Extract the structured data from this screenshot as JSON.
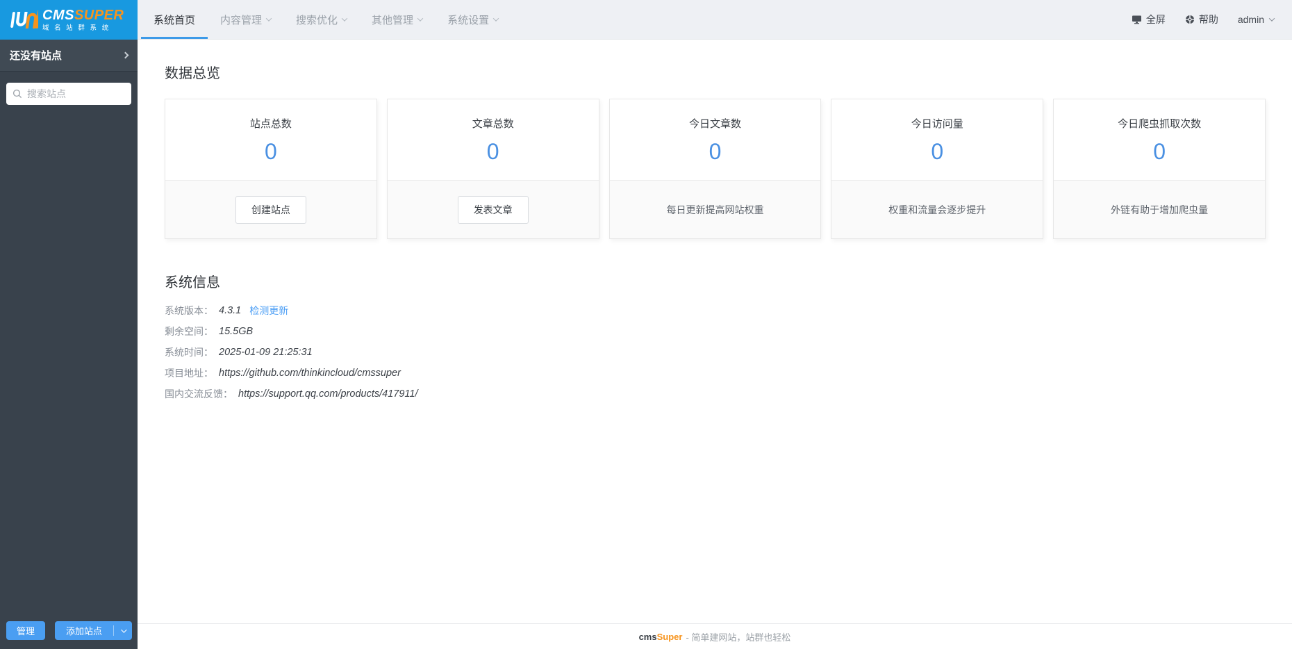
{
  "logo": {
    "brand_cms": "CMS",
    "brand_super": "SUPER",
    "subtitle": "域 名 站 群 系 统"
  },
  "nav": {
    "tabs": [
      {
        "label": "系统首页",
        "active": true,
        "dropdown": false
      },
      {
        "label": "内容管理",
        "active": false,
        "dropdown": true
      },
      {
        "label": "搜索优化",
        "active": false,
        "dropdown": true
      },
      {
        "label": "其他管理",
        "active": false,
        "dropdown": true
      },
      {
        "label": "系统设置",
        "active": false,
        "dropdown": true
      }
    ]
  },
  "topbar": {
    "fullscreen_label": "全屏",
    "help_label": "帮助",
    "user_label": "admin"
  },
  "sidebar": {
    "no_sites_label": "还没有站点",
    "search_placeholder": "搜索站点",
    "manage_button": "管理",
    "add_site_button": "添加站点"
  },
  "overview": {
    "title": "数据总览",
    "cards": [
      {
        "title": "站点总数",
        "value": "0",
        "action": "创建站点"
      },
      {
        "title": "文章总数",
        "value": "0",
        "action": "发表文章"
      },
      {
        "title": "今日文章数",
        "value": "0",
        "note": "每日更新提高网站权重"
      },
      {
        "title": "今日访问量",
        "value": "0",
        "note": "权重和流量会逐步提升"
      },
      {
        "title": "今日爬虫抓取次数",
        "value": "0",
        "note": "外链有助于增加爬虫量"
      }
    ]
  },
  "system_info": {
    "title": "系统信息",
    "rows": [
      {
        "label": "系统版本：",
        "value": "4.3.1",
        "link": "检测更新"
      },
      {
        "label": "剩余空间：",
        "value": "15.5GB"
      },
      {
        "label": "系统时间：",
        "value": "2025-01-09 21:25:31"
      },
      {
        "label": "项目地址：",
        "value": "https://github.com/thinkincloud/cmssuper"
      },
      {
        "label": "国内交流反馈：",
        "value": "https://support.qq.com/products/417911/"
      }
    ]
  },
  "footer": {
    "brand_cms": "cms",
    "brand_super": "Super",
    "tagline": "- 简单建网站，站群也轻松"
  },
  "colors": {
    "brand_blue": "#1899e0",
    "sidebar_dark": "#39424c",
    "accent_orange": "#f7941e",
    "tab_underline_blue": "#3d9ae8",
    "stat_value_blue": "#4a90e2",
    "link_blue": "#4b9ef5",
    "button_blue": "#4a9ef2"
  }
}
